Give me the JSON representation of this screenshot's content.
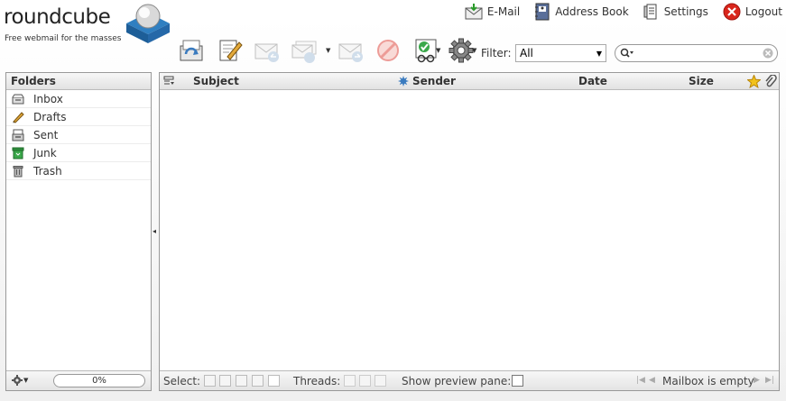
{
  "logo": {
    "word": "roundcube",
    "tagline": "Free webmail for the masses"
  },
  "topnav": {
    "email": "E-Mail",
    "addressbook": "Address Book",
    "settings": "Settings",
    "logout": "Logout"
  },
  "toolbar": {
    "buttons": [
      {
        "name": "check-mail",
        "enabled": true
      },
      {
        "name": "compose",
        "enabled": true
      },
      {
        "name": "reply",
        "enabled": false
      },
      {
        "name": "reply-all",
        "enabled": false
      },
      {
        "name": "forward",
        "enabled": false
      },
      {
        "name": "delete",
        "enabled": false
      },
      {
        "name": "mark",
        "enabled": true
      },
      {
        "name": "more-actions",
        "enabled": true
      }
    ],
    "filter_label": "Filter:",
    "filter_value": "All"
  },
  "search": {
    "value": "",
    "placeholder": ""
  },
  "folders": {
    "header": "Folders",
    "items": [
      {
        "label": "Inbox",
        "icon": "inbox-icon"
      },
      {
        "label": "Drafts",
        "icon": "drafts-icon"
      },
      {
        "label": "Sent",
        "icon": "sent-icon"
      },
      {
        "label": "Junk",
        "icon": "junk-icon"
      },
      {
        "label": "Trash",
        "icon": "trash-icon"
      }
    ],
    "quota": "0%"
  },
  "message_list": {
    "columns": {
      "subject": "Subject",
      "sender": "Sender",
      "date": "Date",
      "size": "Size"
    },
    "rows": []
  },
  "footer": {
    "select_label": "Select:",
    "threads_label": "Threads:",
    "preview_label": "Show preview pane:",
    "count": "Mailbox is empty"
  },
  "colors": {
    "accent": "#3a7bbf",
    "logout_red": "#d9261c",
    "border": "#999999"
  }
}
